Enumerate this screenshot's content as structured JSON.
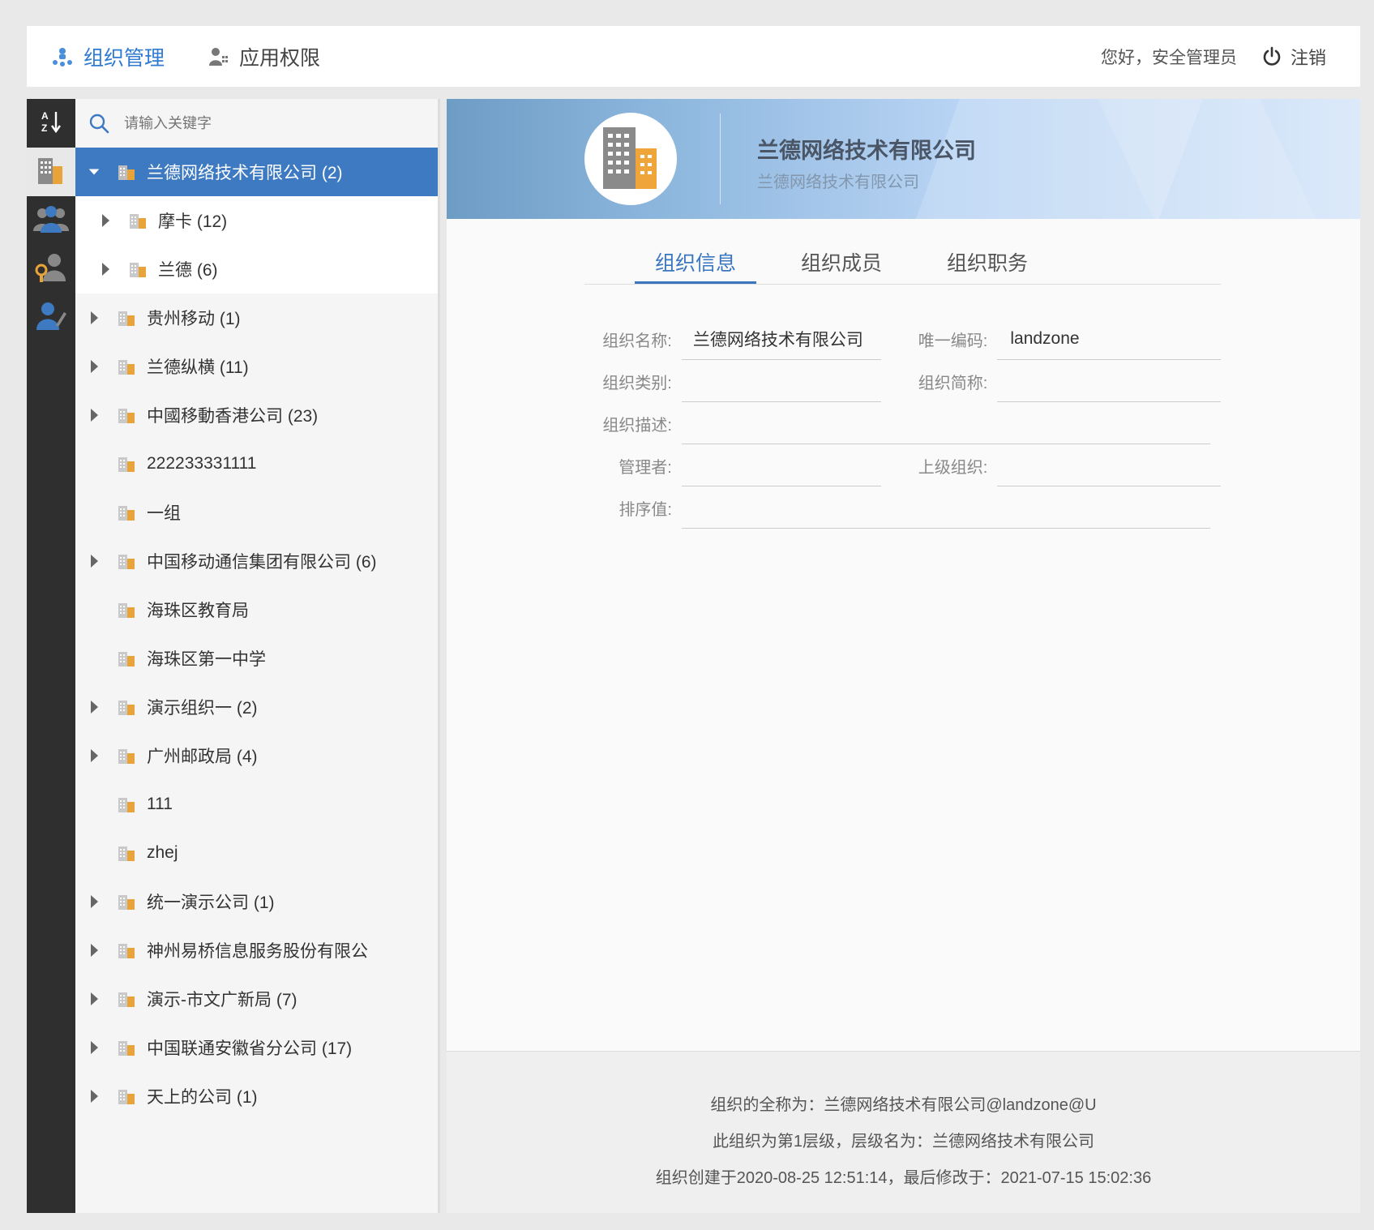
{
  "header": {
    "tabs": [
      {
        "label": "组织管理",
        "icon": "org-chart-icon",
        "active": true
      },
      {
        "label": "应用权限",
        "icon": "user-key-icon",
        "active": false
      }
    ],
    "greeting": "您好，安全管理员",
    "logout_label": "注销"
  },
  "colors": {
    "accent": "#3d7ac1",
    "sidebar_dark": "#2f2f2f",
    "folder": "#e8a33a"
  },
  "sidebar": {
    "icons": [
      "sort-az-icon",
      "building-icon",
      "group-users-icon",
      "role-users-icon",
      "user-edit-icon"
    ]
  },
  "search": {
    "placeholder": "请输入关键字"
  },
  "tree": {
    "root": {
      "label": "兰德网络技术有限公司 (2)",
      "expanded": true
    },
    "children": [
      {
        "label": "摩卡 (12)",
        "has_children": true
      },
      {
        "label": "兰德 (6)",
        "has_children": true
      }
    ],
    "items": [
      {
        "label": "贵州移动 (1)",
        "has_children": true
      },
      {
        "label": "兰德纵横 (11)",
        "has_children": true
      },
      {
        "label": "中國移動香港公司 (23)",
        "has_children": true
      },
      {
        "label": "222233331111",
        "has_children": false
      },
      {
        "label": "一组",
        "has_children": false
      },
      {
        "label": "中国移动通信集团有限公司 (6)",
        "has_children": true
      },
      {
        "label": "海珠区教育局",
        "has_children": false
      },
      {
        "label": "海珠区第一中学",
        "has_children": false
      },
      {
        "label": "演示组织一 (2)",
        "has_children": true
      },
      {
        "label": "广州邮政局 (4)",
        "has_children": true
      },
      {
        "label": "111",
        "has_children": false
      },
      {
        "label": "zhej",
        "has_children": false
      },
      {
        "label": "统一演示公司 (1)",
        "has_children": true
      },
      {
        "label": "神州易桥信息服务股份有限公",
        "has_children": true
      },
      {
        "label": "演示-市文广新局 (7)",
        "has_children": true
      },
      {
        "label": "中国联通安徽省分公司 (17)",
        "has_children": true
      },
      {
        "label": "天上的公司 (1)",
        "has_children": true
      }
    ]
  },
  "banner": {
    "title": "兰德网络技术有限公司",
    "subtitle": "兰德网络技术有限公司"
  },
  "tabs": [
    {
      "label": "组织信息",
      "active": true
    },
    {
      "label": "组织成员",
      "active": false
    },
    {
      "label": "组织职务",
      "active": false
    }
  ],
  "form": {
    "name_label": "组织名称:",
    "name_value": "兰德网络技术有限公司",
    "code_label": "唯一编码:",
    "code_value": "landzone",
    "type_label": "组织类别:",
    "type_value": "",
    "short_label": "组织简称:",
    "short_value": "",
    "desc_label": "组织描述:",
    "desc_value": "",
    "manager_label": "管理者:",
    "manager_value": "",
    "parent_label": "上级组织:",
    "parent_value": "",
    "order_label": "排序值:",
    "order_value": ""
  },
  "footer": {
    "line1": "组织的全称为：兰德网络技术有限公司@landzone@U",
    "line2": "此组织为第1层级，层级名为：兰德网络技术有限公司",
    "line3": "组织创建于2020-08-25 12:51:14，最后修改于：2021-07-15 15:02:36"
  }
}
